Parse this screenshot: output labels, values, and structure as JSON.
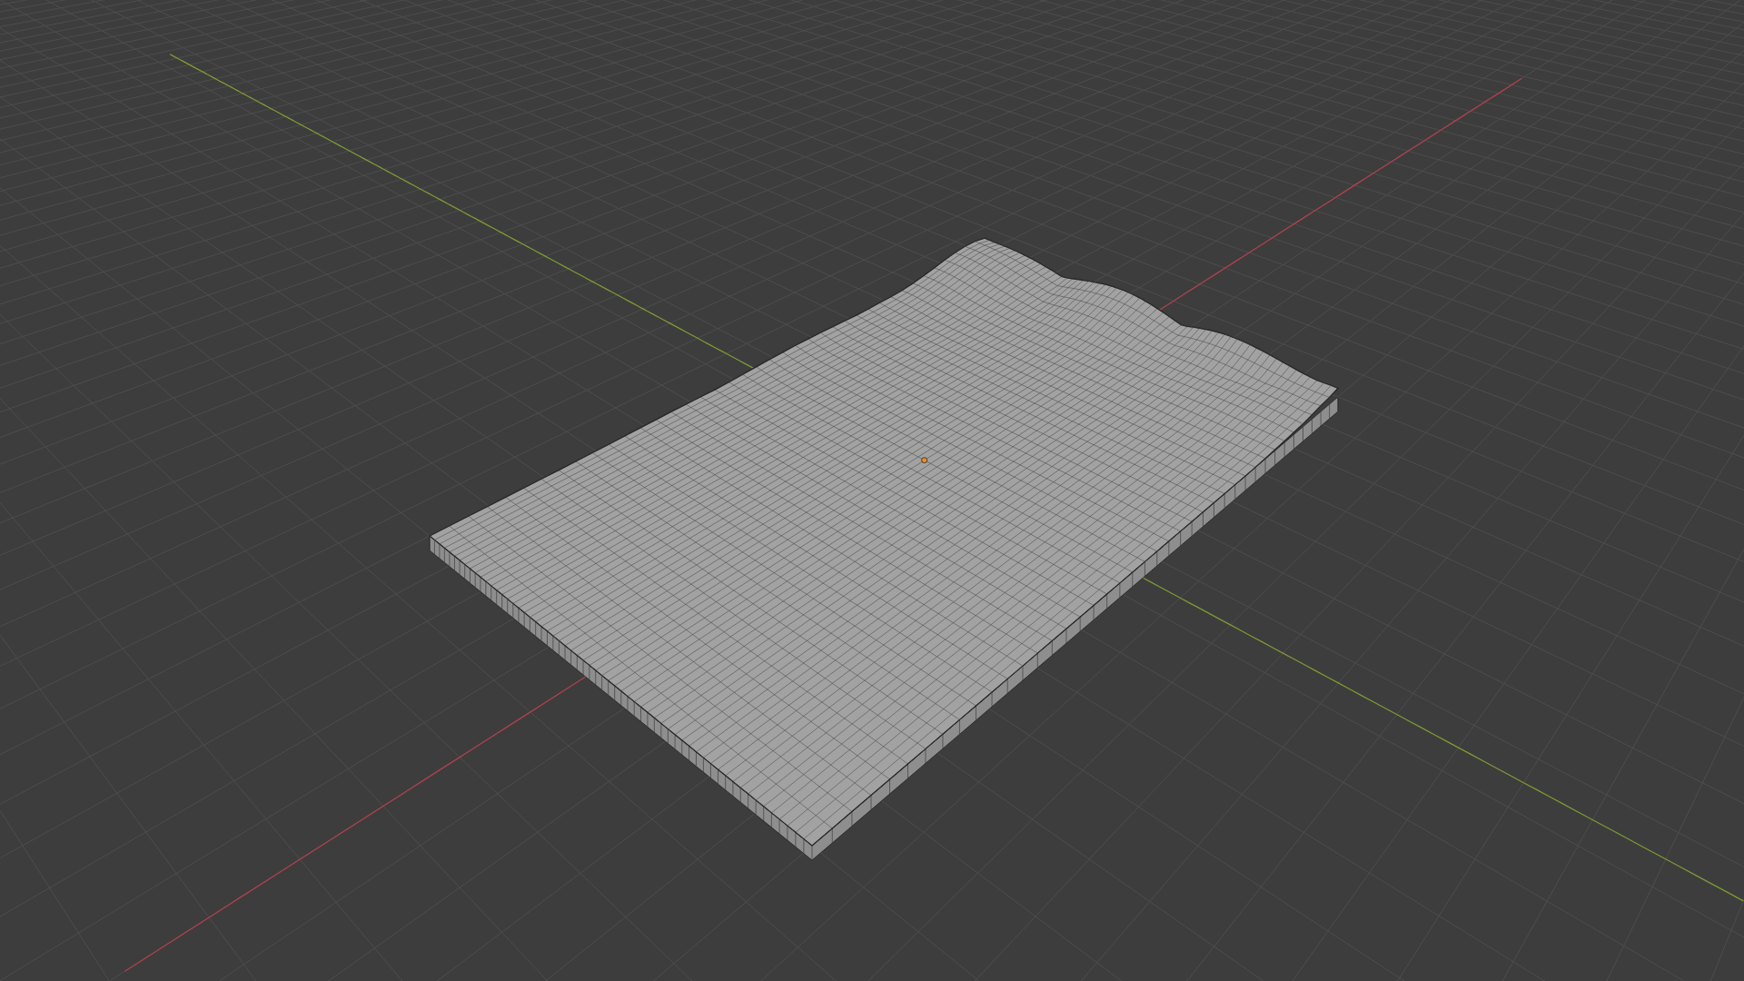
{
  "viewport": {
    "object": {
      "selected": true
    }
  }
}
